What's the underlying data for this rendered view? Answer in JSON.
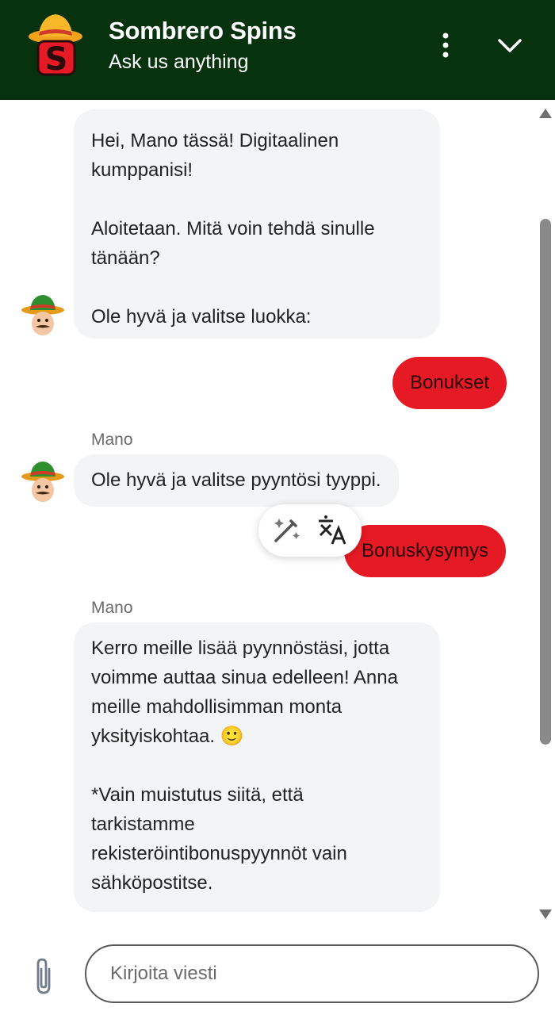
{
  "header": {
    "title": "Sombrero Spins",
    "subtitle": "Ask us anything",
    "logo_letter": "S",
    "background": "#06320e"
  },
  "messages": {
    "bot1": "Hei, Mano tässä! Digitaalinen\nkumppanisi!\n\nAloitetaan. Mitä voin tehdä sinulle\ntänään?\n\nOle hyvä ja valitse luokka:",
    "user1": "Bonukset",
    "sender2": "Mano",
    "bot2": "Ole hyvä ja valitse pyyntösi tyyppi.",
    "user2": "Bonuskysymys",
    "sender3": "Mano",
    "bot3": "Kerro meille lisää pyynnöstäsi, jotta\nvoimme auttaa sinua edelleen! Anna\nmeille mahdollisimman monta\nyksityiskohtaa. 🙂\n\n*Vain muistutus siitä, että\ntarkistamme\nrekisteröintibonuspyynnöt vain\nsähköpostitse."
  },
  "composer": {
    "placeholder": "Kirjoita viesti"
  },
  "colors": {
    "user_bubble": "#e51a24",
    "bot_bubble": "#f3f4f6"
  },
  "icons": [
    "sombrero-logo",
    "more-vertical-icon",
    "chevron-down-icon",
    "magic-wand-icon",
    "translate-icon",
    "paperclip-icon",
    "avatar-mano"
  ]
}
